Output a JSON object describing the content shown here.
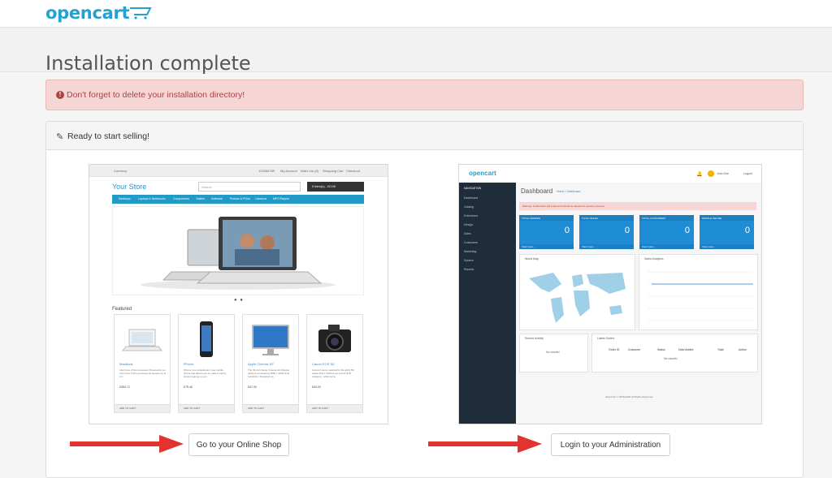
{
  "brand": {
    "name": "opencart",
    "accent": "#23a1d1"
  },
  "page": {
    "title": "Installation complete"
  },
  "alert": {
    "icon": "exclamation-circle-icon",
    "message": "Don't forget to delete your installation directory!",
    "color": "#a94442",
    "background": "#f5d6d4"
  },
  "panel": {
    "icon": "pencil-icon",
    "heading": "Ready to start selling!"
  },
  "actions": {
    "shop_button": "Go to your Online Shop",
    "admin_button": "Login to your Administration",
    "arrow_color": "#e2332f"
  },
  "store_preview": {
    "topbar": [
      "Currency",
      "123456789",
      "My Account",
      "Wish List (0)",
      "Shopping Cart",
      "Checkout"
    ],
    "store_name": "Your Store",
    "search_placeholder": "Search",
    "cart": "0 item(s) - £0.00",
    "menu": [
      "Desktops",
      "Laptops & Notebooks",
      "Components",
      "Tablets",
      "Software",
      "Phones & PDAs",
      "Cameras",
      "MP3 Players"
    ],
    "featured_title": "Featured",
    "products": [
      {
        "name": "MacBook",
        "desc": "Intel Core 2 Duo processor Powered by an Intel Core 2 Duo processor at speeds up to 2.1..",
        "price": "£390.72"
      },
      {
        "name": "iPhone",
        "desc": "iPhone is a revolutionary new mobile phone that allows you to make a call by simply tapping a nam..",
        "price": "£75.46"
      },
      {
        "name": "Apple Cinema 30\"",
        "desc": "The 30-inch Apple Cinema HD Display delivers an amazing 2560 x 1600 pixel resolution. Designed sp..",
        "price": "£67.30"
      },
      {
        "name": "Canon EOS 5D",
        "desc": "Canon's press material for the EOS 5D states that it 'defines (a) new D-SLR category', while we're..",
        "price": "£60.03"
      }
    ],
    "add_to_cart": "ADD TO CART"
  },
  "admin_preview": {
    "logo": "opencart",
    "user": "John Doe",
    "logout": "Logout",
    "nav_title": "NAVIGATION",
    "nav": [
      "Dashboard",
      "Catalog",
      "Extensions",
      "Design",
      "Sales",
      "Customers",
      "Marketing",
      "System",
      "Reports"
    ],
    "title": "Dashboard",
    "breadcrumb": "Home / Dashboard",
    "warning": "Warning: Install folder still exists and should be deleted for security reasons!",
    "tiles": [
      {
        "label": "TOTAL ORDERS",
        "pct": "0%",
        "value": "0"
      },
      {
        "label": "TOTAL SALES",
        "pct": "0%",
        "value": "0"
      },
      {
        "label": "TOTAL CUSTOMERS",
        "pct": "0%",
        "value": "0"
      },
      {
        "label": "PEOPLE ONLINE",
        "pct": "",
        "value": "0"
      }
    ],
    "view_more": "View more...",
    "world_map": "World Map",
    "sales_analytics": "Sales Analytics",
    "recent_activity": "Recent Activity",
    "latest_orders": "Latest Orders",
    "no_results": "No results!",
    "orders_columns": [
      "Order ID",
      "Customer",
      "Status",
      "Date Added",
      "Total",
      "Action"
    ],
    "footer": "OpenCart © 2009-2020 All Rights Reserved."
  }
}
